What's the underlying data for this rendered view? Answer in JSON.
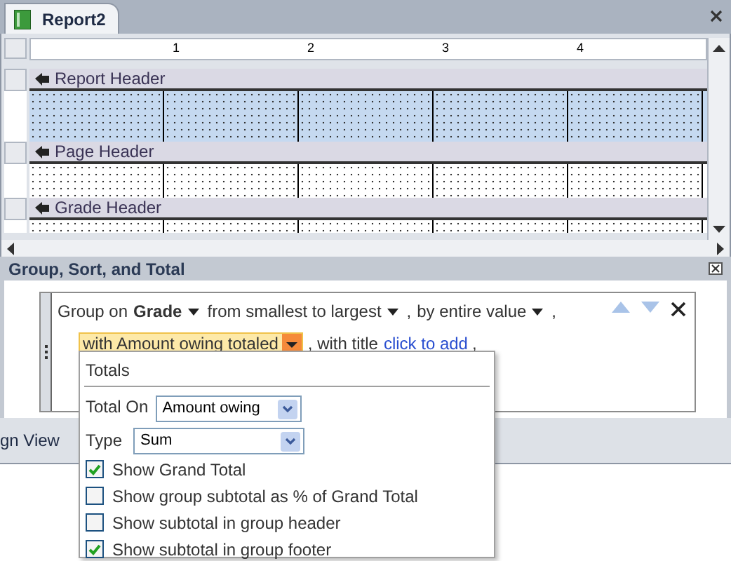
{
  "document_tab": {
    "title": "Report2",
    "selected": true
  },
  "ruler": {
    "marks": [
      "1",
      "2",
      "3",
      "4"
    ]
  },
  "sections": [
    {
      "title": "Report Header",
      "selected": true
    },
    {
      "title": "Page Header",
      "selected": false
    },
    {
      "title": "Grade Header",
      "selected": false
    }
  ],
  "group_pane": {
    "title": "Group, Sort, and Total",
    "lines": [
      [
        {
          "kind": "label",
          "text": "Group on"
        },
        {
          "kind": "dropdown",
          "text": "Grade",
          "bold": true
        },
        {
          "kind": "dropdown",
          "text": "from smallest to largest",
          "bold": false
        },
        {
          "kind": "punct",
          "text": ","
        },
        {
          "kind": "dropdown",
          "text": "by entire value",
          "bold": false
        },
        {
          "kind": "punct",
          "text": ","
        }
      ],
      [
        {
          "kind": "active",
          "text": "with Amount owing totaled"
        },
        {
          "kind": "label",
          "text": ", with title"
        },
        {
          "kind": "link",
          "text": "click to add"
        },
        {
          "kind": "punct",
          "text": ","
        }
      ]
    ]
  },
  "status_bar": {
    "view": "gn View"
  },
  "totals_popup": {
    "heading": "Totals",
    "total_on_label": "Total On",
    "total_on": "Amount owing",
    "type_label": "Type",
    "type": "Sum",
    "options": [
      {
        "label": "Show Grand Total",
        "checked": true
      },
      {
        "label": "Show group subtotal as % of Grand Total",
        "checked": false
      },
      {
        "label": "Show subtotal in group header",
        "checked": false
      },
      {
        "label": "Show subtotal in group footer",
        "checked": true
      }
    ]
  }
}
